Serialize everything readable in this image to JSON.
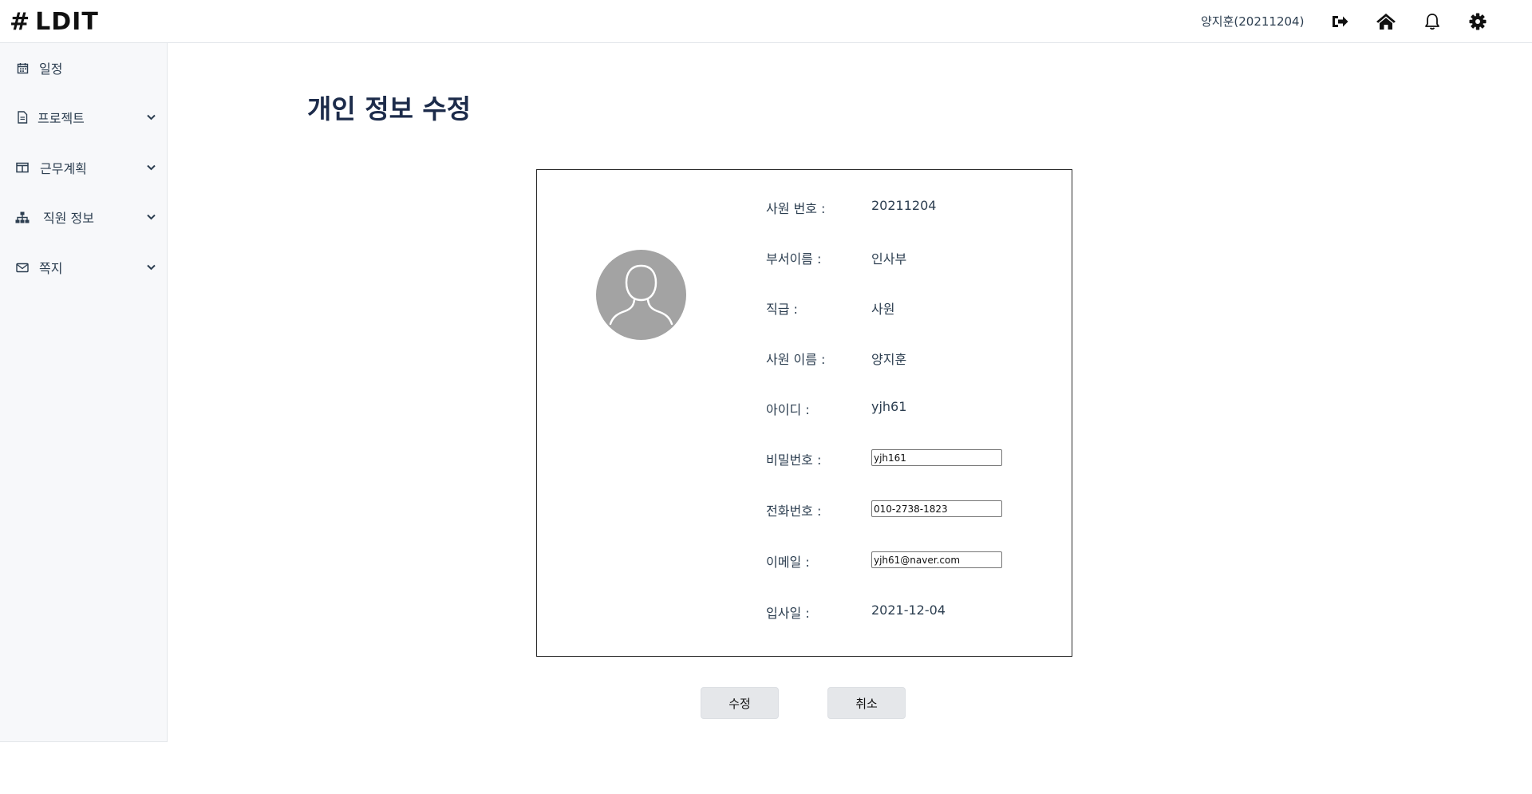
{
  "header": {
    "logo_text": "LDIT",
    "logo_mark": "#",
    "user": "양지훈(20211204)",
    "icons": [
      "logout-icon",
      "home-icon",
      "bell-icon",
      "gear-icon"
    ]
  },
  "sidebar": {
    "items": [
      {
        "label": "일정",
        "icon": "calendar-icon",
        "expandable": false
      },
      {
        "label": "프로젝트",
        "icon": "file-icon",
        "expandable": true
      },
      {
        "label": "근무계획",
        "icon": "table-icon",
        "expandable": true
      },
      {
        "label": "직원 정보",
        "icon": "sitemap-icon",
        "expandable": true
      },
      {
        "label": "쪽지",
        "icon": "envelope-icon",
        "expandable": true
      }
    ]
  },
  "main": {
    "title": "개인 정보 수정",
    "fields": [
      {
        "label": "사원 번호 :",
        "value": "20211204"
      },
      {
        "label": "부서이름 :",
        "value": "인사부"
      },
      {
        "label": "직급 :",
        "value": "사원"
      },
      {
        "label": "사원 이름 :",
        "value": "양지훈"
      },
      {
        "label": "아이디 :",
        "value": "yjh61"
      },
      {
        "label": "비밀번호 :",
        "value": "yjh161"
      },
      {
        "label": "전화번호 :",
        "value": "010-2738-1823"
      },
      {
        "label": "이메일 :",
        "value": "yjh61@naver.com"
      },
      {
        "label": "입사일 :",
        "value": "2021-12-04"
      }
    ],
    "buttons": {
      "submit": "수정",
      "cancel": "취소"
    }
  },
  "colors": {
    "title": "#1c2b4a",
    "sidebar_bg": "#f7f8fa",
    "avatar": "#a3a3a3",
    "button_bg": "#e5e7ea"
  }
}
